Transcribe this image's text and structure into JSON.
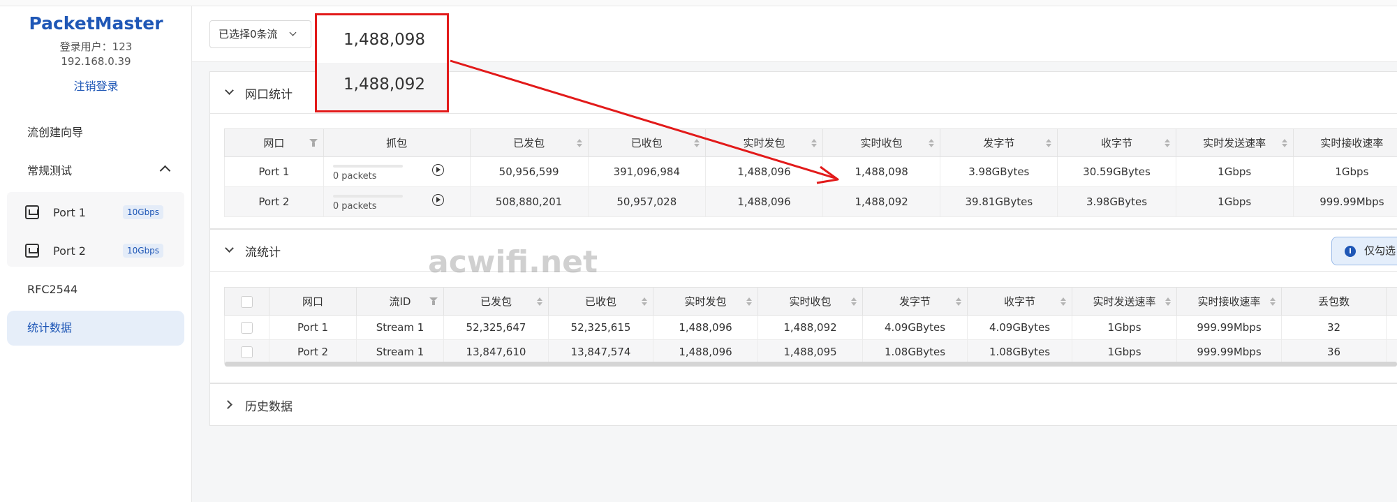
{
  "sidebar": {
    "brand": "PacketMaster",
    "user": "登录用户：123",
    "ip": "192.168.0.39",
    "logout": "注销登录",
    "nav": {
      "wizard": "流创建向导",
      "regular": "常规测试",
      "rfc": "RFC2544",
      "stats": "统计数据"
    },
    "ports": [
      {
        "label": "Port 1",
        "speed": "10Gbps"
      },
      {
        "label": "Port 2",
        "speed": "10Gbps"
      }
    ]
  },
  "toolbar": {
    "selected_flows": "已选择0条流"
  },
  "callout": {
    "top_value": "1,488,098",
    "bottom_value": "1,488,092"
  },
  "port_stats": {
    "title": "网口统计",
    "headers": [
      "网口",
      "抓包",
      "已发包",
      "已收包",
      "实时发包",
      "实时收包",
      "发字节",
      "收字节",
      "实时发送速率",
      "实时接收速率"
    ],
    "rows": [
      {
        "port": "Port 1",
        "capture": "0 packets",
        "tx": "50,956,599",
        "rx": "391,096,984",
        "rt_tx": "1,488,096",
        "rt_rx": "1,488,098",
        "tx_bytes": "3.98GBytes",
        "rx_bytes": "30.59GBytes",
        "tx_rate": "1Gbps",
        "rx_rate": "1Gbps"
      },
      {
        "port": "Port 2",
        "capture": "0 packets",
        "tx": "508,880,201",
        "rx": "50,957,028",
        "rt_tx": "1,488,096",
        "rt_rx": "1,488,092",
        "tx_bytes": "39.81GBytes",
        "rx_bytes": "3.98GBytes",
        "tx_rate": "1Gbps",
        "rx_rate": "999.99Mbps"
      }
    ]
  },
  "flow_stats": {
    "title": "流统计",
    "info_button": "仅勾选",
    "headers": [
      "网口",
      "流ID",
      "已发包",
      "已收包",
      "实时发包",
      "实时收包",
      "发字节",
      "收字节",
      "实时发送速率",
      "实时接收速率",
      "丢包数"
    ],
    "rows": [
      {
        "port": "Port 1",
        "stream": "Stream 1",
        "tx": "52,325,647",
        "rx": "52,325,615",
        "rt_tx": "1,488,096",
        "rt_rx": "1,488,092",
        "tx_bytes": "4.09GBytes",
        "rx_bytes": "4.09GBytes",
        "tx_rate": "1Gbps",
        "rx_rate": "999.99Mbps",
        "loss": "32"
      },
      {
        "port": "Port 2",
        "stream": "Stream 1",
        "tx": "13,847,610",
        "rx": "13,847,574",
        "rt_tx": "1,488,096",
        "rt_rx": "1,488,095",
        "tx_bytes": "1.08GBytes",
        "rx_bytes": "1.08GBytes",
        "tx_rate": "1Gbps",
        "rx_rate": "999.99Mbps",
        "loss": "36"
      }
    ]
  },
  "history": {
    "title": "历史数据"
  },
  "watermark": "acwifi.net",
  "colors": {
    "brand": "#1f57b6",
    "annotation": "#e21a1a",
    "active_nav_bg": "#e6eef9"
  }
}
